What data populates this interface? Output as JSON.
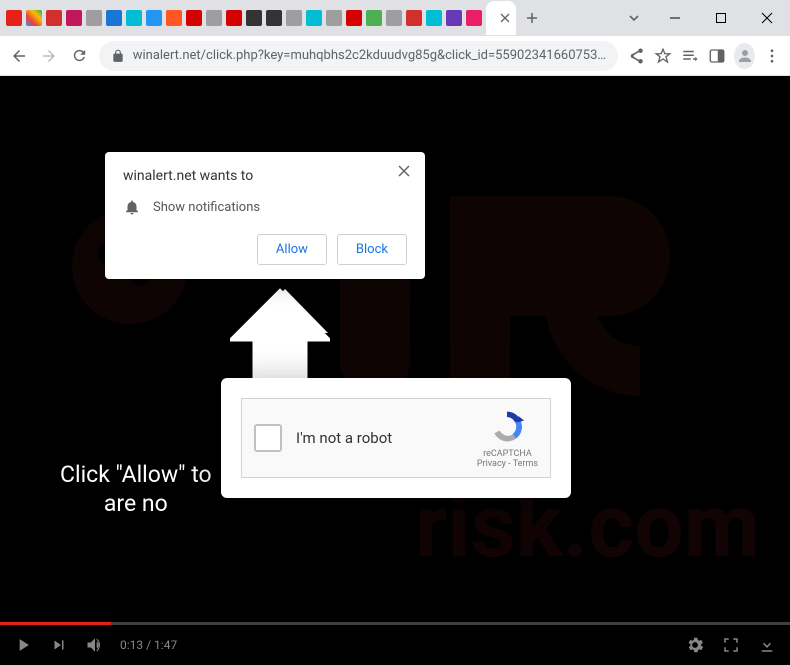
{
  "window": {
    "address_url": "winalert.net/click.php?key=muhqbhs2c2kduudvg85g&click_id=55902341660753…"
  },
  "permission_popup": {
    "title": "winalert.net wants to",
    "line": "Show notifications",
    "allow": "Allow",
    "block": "Block"
  },
  "instruction": {
    "line1": "Click \"Allow\" to",
    "line2": "are no"
  },
  "captcha": {
    "label": "I'm not a robot",
    "brand": "reCAPTCHA",
    "privacy": "Privacy",
    "terms": "Terms",
    "sep": " - "
  },
  "player": {
    "current": "0:13",
    "sep": " / ",
    "duration": "1:47"
  },
  "watermark": {
    "text": "risk.com"
  }
}
